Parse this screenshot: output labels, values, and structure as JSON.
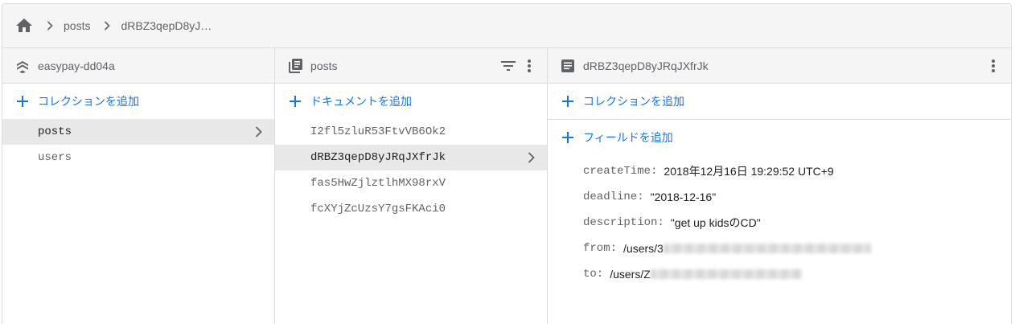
{
  "breadcrumb": {
    "home_icon": "home-icon",
    "items": [
      "posts",
      "dRBZ3qepD8yJ…"
    ]
  },
  "panels": {
    "project": {
      "title": "easypay-dd04a",
      "icon": "firestore-icon",
      "add_label": "コレクションを追加",
      "items": [
        {
          "label": "posts",
          "selected": true
        },
        {
          "label": "users",
          "selected": false
        }
      ]
    },
    "collection": {
      "title": "posts",
      "icon": "collection-icon",
      "add_label": "ドキュメントを追加",
      "items": [
        {
          "label": "I2fl5zluR53FtvVB6Ok2",
          "selected": false
        },
        {
          "label": "dRBZ3qepD8yJRqJXfrJk",
          "selected": true
        },
        {
          "label": "fas5HwZjlztlhMX98rxV",
          "selected": false
        },
        {
          "label": "fcXYjZcUzsY7gsFKAci0",
          "selected": false
        }
      ]
    },
    "document": {
      "title": "dRBZ3qepD8yJRqJXfrJk",
      "icon": "document-icon",
      "add_collection_label": "コレクションを追加",
      "add_field_label": "フィールドを追加",
      "fields": [
        {
          "key": "createTime:",
          "value": "2018年12月16日 19:29:52 UTC+9"
        },
        {
          "key": "deadline:",
          "value": "\"2018-12-16\""
        },
        {
          "key": "description:",
          "value": "\"get up kidsのCD\""
        },
        {
          "key": "from:",
          "value": "/users/3"
        },
        {
          "key": "to:",
          "value": "/users/Z"
        }
      ]
    }
  },
  "colors": {
    "accent": "#1a73e8",
    "header_bg": "#f5f5f5",
    "selected_bg": "#e8e8e8",
    "border": "#dadce0"
  }
}
